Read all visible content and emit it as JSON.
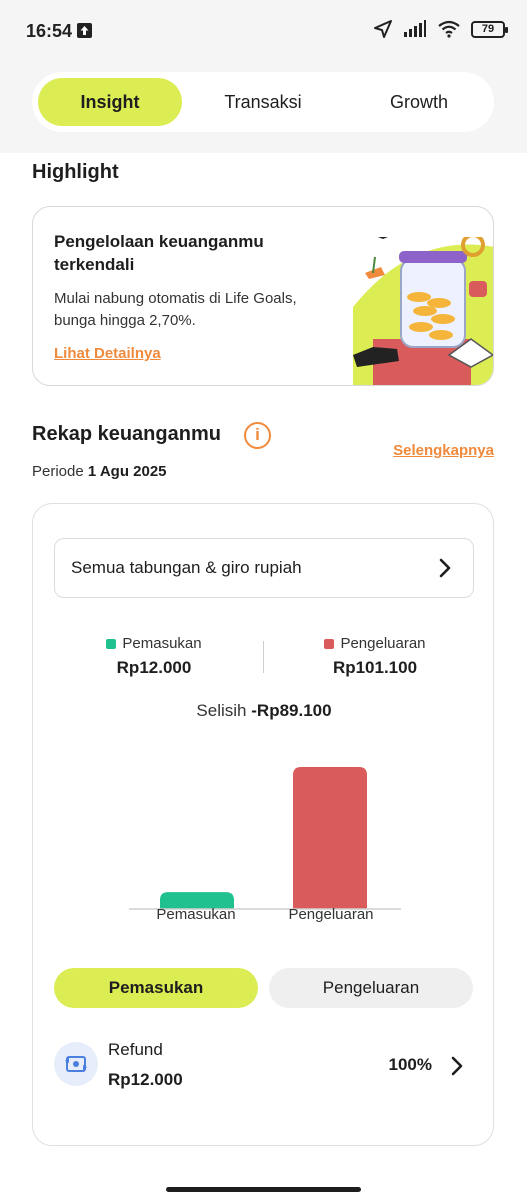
{
  "status_bar": {
    "time": "16:54",
    "battery": "79"
  },
  "tabs": [
    {
      "label": "Insight",
      "active": true
    },
    {
      "label": "Transaksi",
      "active": false
    },
    {
      "label": "Growth",
      "active": false
    }
  ],
  "highlight": {
    "section_title": "Highlight",
    "card_title": "Pengelolaan keuanganmu terkendali",
    "card_desc": "Mulai nabung otomatis di Life Goals, bunga hingga 2,70%.",
    "card_link": "Lihat Detailnya"
  },
  "rekap": {
    "title": "Rekap keuanganmu",
    "see_more": "Selengkapnya",
    "periode_label": "Periode",
    "periode_value": "1 Agu 2025",
    "account_select": "Semua tabungan & giro rupiah",
    "income_label": "Pemasukan",
    "income_amount": "Rp12.000",
    "expense_label": "Pengeluaran",
    "expense_amount": "Rp101.100",
    "selisih_label": "Selisih",
    "selisih_value": "-Rp89.100",
    "segment_income": "Pemasukan",
    "segment_expense": "Pengeluaran",
    "list": [
      {
        "label": "Refund",
        "amount": "Rp12.000",
        "percent": "100%"
      }
    ]
  },
  "colors": {
    "accent": "#dcec53",
    "income": "#1fc28f",
    "expense": "#d95b5b",
    "link": "#f08a3c"
  },
  "chart_data": {
    "type": "bar",
    "categories": [
      "Pemasukan",
      "Pengeluaran"
    ],
    "values": [
      12000,
      101100
    ]
  }
}
